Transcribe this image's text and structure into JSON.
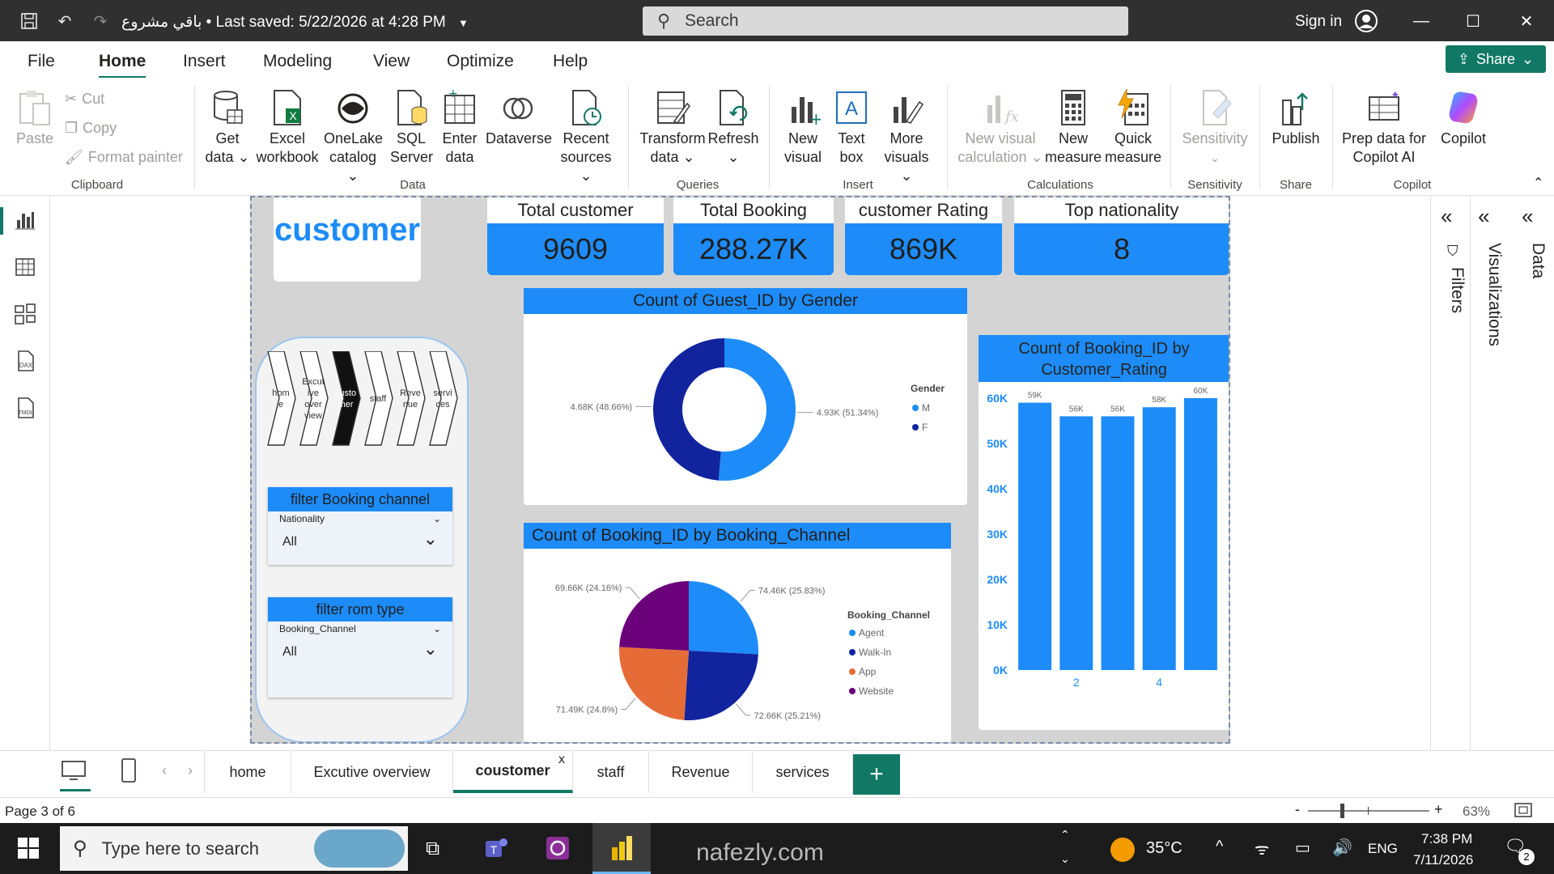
{
  "app": {
    "doc_title": "باقي مشروع • Last saved: 5/22/2026 at 4:28 PM",
    "search_placeholder": "Search",
    "sign_in": "Sign in"
  },
  "menu": {
    "tabs": [
      "File",
      "Home",
      "Insert",
      "Modeling",
      "View",
      "Optimize",
      "Help"
    ],
    "active": "Home",
    "share_label": "Share"
  },
  "ribbon": {
    "clipboard": {
      "paste": "Paste",
      "cut": "Cut",
      "copy": "Copy",
      "format_painter": "Format painter",
      "group": "Clipboard"
    },
    "data": {
      "get_data": "Get data ⌄",
      "excel": "Excel workbook",
      "onelake": "OneLake catalog ⌄",
      "sql": "SQL Server",
      "enter": "Enter data",
      "dataverse": "Dataverse",
      "recent": "Recent sources ⌄",
      "group": "Data"
    },
    "queries": {
      "transform": "Transform data ⌄",
      "refresh": "Refresh ⌄",
      "group": "Queries"
    },
    "insert": {
      "new_visual": "New visual",
      "text_box": "Text box",
      "more_visuals": "More visuals ⌄",
      "group": "Insert"
    },
    "calculations": {
      "new_visual_calc": "New visual calculation ⌄",
      "new_measure": "New measure",
      "quick_measure": "Quick measure",
      "group": "Calculations"
    },
    "sensitivity": {
      "label": "Sensitivity",
      "group": "Sensitivity"
    },
    "share": {
      "publish": "Publish",
      "group": "Share"
    },
    "copilot": {
      "prep": "Prep data for Copilot AI",
      "copilot": "Copilot",
      "group": "Copilot"
    }
  },
  "report": {
    "header_title": "customer",
    "kpis": [
      {
        "title": "Total customer",
        "value": "9609"
      },
      {
        "title": "Total Booking",
        "value": "288.27K"
      },
      {
        "title": "customer Rating",
        "value": "869K"
      },
      {
        "title": "Top nationality",
        "value": "8"
      }
    ],
    "nav_buttons": [
      "hom e",
      "Excut ive over view",
      "custo mer",
      "staff",
      "Reve nue",
      "servi ces"
    ],
    "slicers": [
      {
        "title": "filter Booking channel",
        "field": "Nationality",
        "value": "All"
      },
      {
        "title": "filter rom type",
        "field": "Booking_Channel",
        "value": "All"
      }
    ]
  },
  "chart_data": [
    {
      "type": "pie",
      "variant": "donut",
      "title": "Count of Guest_ID by Gender",
      "legend_title": "Gender",
      "legend_position": "right",
      "categories": [
        "M",
        "F"
      ],
      "values": [
        4930,
        4680
      ],
      "labels": [
        "4.93K (51.34%)",
        "4.68K (48.66%)"
      ],
      "colors": [
        "#1d8cf8",
        "#12239e"
      ]
    },
    {
      "type": "pie",
      "title": "Count of Booking_ID by Booking_Channel",
      "legend_title": "Booking_Channel",
      "legend_position": "right",
      "categories": [
        "Agent",
        "Walk-In",
        "App",
        "Website"
      ],
      "values": [
        74460,
        72660,
        71490,
        69660
      ],
      "labels": [
        "74.46K (25.83%)",
        "72.66K (25.21%)",
        "71.49K (24.8%)",
        "69.66K (24.16%)"
      ],
      "colors": [
        "#1d8cf8",
        "#12239e",
        "#e66c37",
        "#6b007b"
      ]
    },
    {
      "type": "bar",
      "title": "Count of Booking_ID by Customer_Rating",
      "categories": [
        1,
        2,
        3,
        4,
        5
      ],
      "x_tick_labels": [
        "2",
        "4"
      ],
      "values": [
        59000,
        56000,
        56000,
        58000,
        60000
      ],
      "data_labels": [
        "59K",
        "56K",
        "56K",
        "58K",
        "60K"
      ],
      "y_ticks": [
        "0K",
        "10K",
        "20K",
        "30K",
        "40K",
        "50K",
        "60K"
      ],
      "ylim": [
        0,
        60000
      ],
      "color": "#1d8cf8"
    }
  ],
  "panes": {
    "filters": "Filters",
    "visualizations": "Visualizations",
    "data": "Data"
  },
  "page_tabs": {
    "tabs": [
      "home",
      "Excutive overview",
      "coustomer",
      "staff",
      "Revenue",
      "services"
    ],
    "active": "coustomer",
    "close_glyph": "x",
    "add_glyph": "+"
  },
  "status": {
    "page": "Page 3 of 6",
    "zoom": "63%",
    "zoom_minus": "-",
    "zoom_plus": "+"
  },
  "taskbar": {
    "search_placeholder": "Type here to search",
    "weather": "35°C",
    "language": "ENG",
    "time": "7:38 PM",
    "date": "7/11/2026",
    "notifications": "2"
  },
  "watermark": "nafezly.com"
}
